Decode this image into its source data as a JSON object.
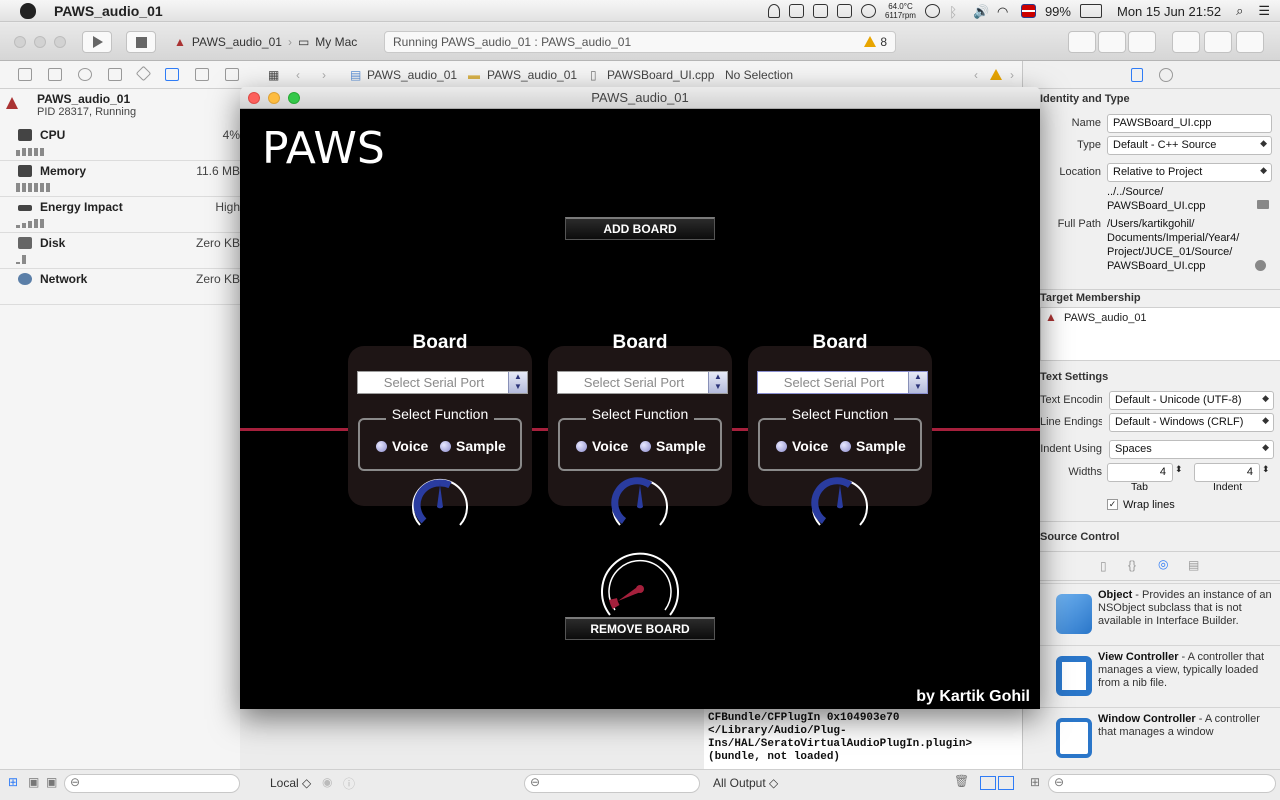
{
  "menubar": {
    "app_name": "PAWS_audio_01",
    "temp": "64.0°C",
    "rpm": "6117rpm",
    "battery": "99%",
    "clock": "Mon 15 Jun  21:52"
  },
  "toolbar": {
    "scheme": "PAWS_audio_01",
    "destination": "My Mac",
    "status": "Running PAWS_audio_01 : PAWS_audio_01",
    "warning_count": "8"
  },
  "debug_nav": {
    "process": "PAWS_audio_01",
    "pid": "PID 28317, Running",
    "gauges": [
      {
        "label": "CPU",
        "value": "4%"
      },
      {
        "label": "Memory",
        "value": "11.6 MB"
      },
      {
        "label": "Energy Impact",
        "value": "High"
      },
      {
        "label": "Disk",
        "value": "Zero KB"
      },
      {
        "label": "Network",
        "value": "Zero KB"
      }
    ]
  },
  "jumpbar": {
    "crumbs": [
      "PAWS_audio_01",
      "PAWS_audio_01",
      "PAWSBoard_UI.cpp",
      "No Selection"
    ]
  },
  "paws_window": {
    "window_title": "PAWS_audio_01",
    "title": "PAWS",
    "add_board": "ADD BOARD",
    "remove_board": "REMOVE BOARD",
    "author": "by Kartik Gohil",
    "boards": [
      {
        "title": "Board",
        "serial_placeholder": "Select Serial Port",
        "function_label": "Select Function",
        "voice": "Voice",
        "sample": "Sample"
      },
      {
        "title": "Board",
        "serial_placeholder": "Select Serial Port",
        "function_label": "Select Function",
        "voice": "Voice",
        "sample": "Sample"
      },
      {
        "title": "Board",
        "serial_placeholder": "Select Serial Port",
        "function_label": "Select Function",
        "voice": "Voice",
        "sample": "Sample"
      }
    ]
  },
  "console": {
    "output": "CFBundle/CFPlugIn 0x104903e70 </Library/Audio/Plug-Ins/HAL/SeratoVirtualAudioPlugIn.plugin> (bundle, not loaded)"
  },
  "bottombar": {
    "local": "Local ◇",
    "output": "All Output ◇"
  },
  "inspector": {
    "identity_header": "Identity and Type",
    "name_label": "Name",
    "name_value": "PAWSBoard_UI.cpp",
    "type_label": "Type",
    "type_value": "Default - C++ Source",
    "location_label": "Location",
    "location_value": "Relative to Project",
    "rel_path_1": "../../Source/",
    "rel_path_2": "PAWSBoard_UI.cpp",
    "fullpath_label": "Full Path",
    "fullpath_1": "/Users/kartikgohil/",
    "fullpath_2": "Documents/Imperial/Year4/",
    "fullpath_3": "Project/JUCE_01/Source/",
    "fullpath_4": "PAWSBoard_UI.cpp",
    "target_header": "Target Membership",
    "target_value": "PAWS_audio_01",
    "text_header": "Text Settings",
    "encoding_label": "Text Encoding",
    "encoding_value": "Default - Unicode (UTF-8)",
    "endings_label": "Line Endings",
    "endings_value": "Default - Windows (CRLF)",
    "indent_label": "Indent Using",
    "indent_value": "Spaces",
    "widths_label": "Widths",
    "tab_value": "4",
    "indent_width_value": "4",
    "tab_label": "Tab",
    "indent_sub_label": "Indent",
    "wrap_label": "Wrap lines",
    "source_header": "Source Control",
    "library": [
      {
        "title": "Object",
        "desc": " - Provides an instance of an NSObject subclass that is not available in Interface Builder."
      },
      {
        "title": "View Controller",
        "desc": " - A controller that manages a view, typically loaded from a nib file."
      },
      {
        "title": "Window Controller",
        "desc": " - A controller that manages a window"
      }
    ]
  }
}
